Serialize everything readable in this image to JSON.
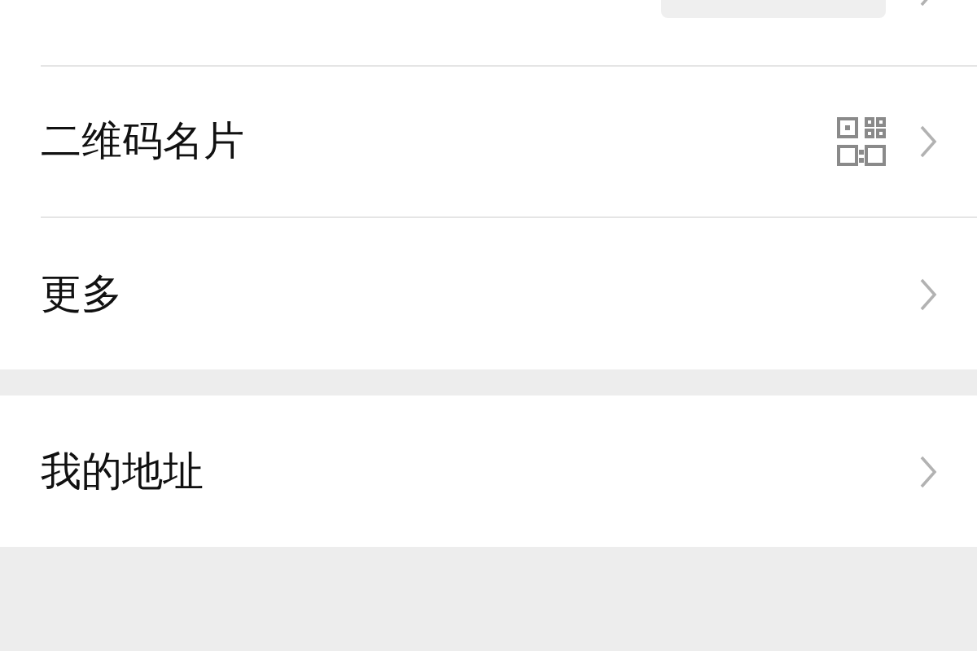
{
  "sections": [
    {
      "rows": [
        {
          "kind": "redacted"
        },
        {
          "label": "二维码名片",
          "kind": "qr"
        },
        {
          "label": "更多",
          "kind": "plain"
        }
      ]
    },
    {
      "rows": [
        {
          "label": "我的地址",
          "kind": "plain"
        }
      ]
    }
  ]
}
